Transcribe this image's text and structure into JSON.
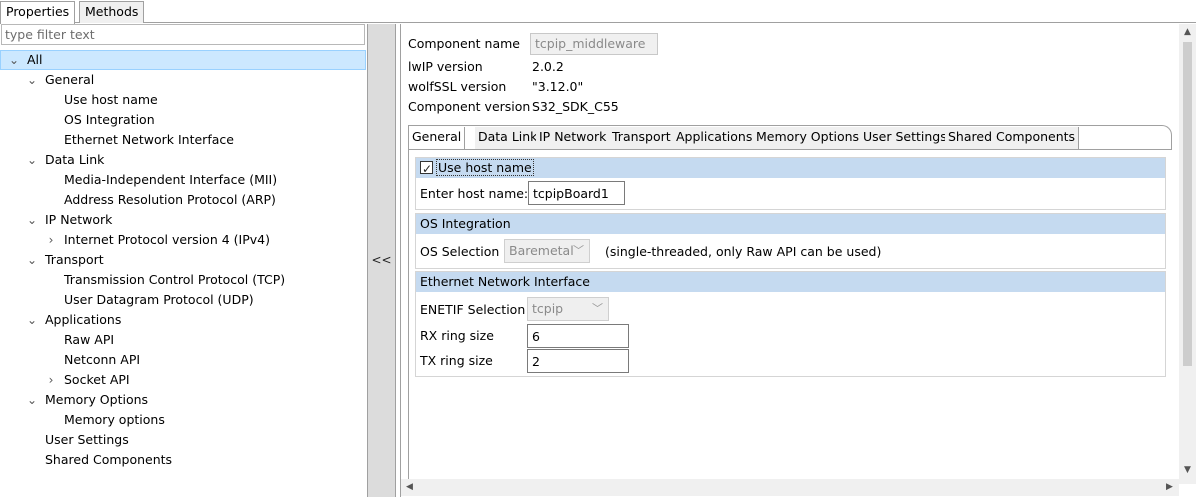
{
  "top_tabs": [
    {
      "label": "Properties",
      "active": true
    },
    {
      "label": "Methods",
      "active": false
    }
  ],
  "filter": {
    "placeholder": "type filter text"
  },
  "tree": [
    {
      "label": "All",
      "expander": "open",
      "selected": true
    },
    {
      "label": "General",
      "expander": "open"
    },
    {
      "label": "Use host name"
    },
    {
      "label": "OS Integration"
    },
    {
      "label": "Ethernet Network Interface"
    },
    {
      "label": "Data Link",
      "expander": "open"
    },
    {
      "label": "Media-Independent Interface (MII)"
    },
    {
      "label": "Address Resolution Protocol (ARP)"
    },
    {
      "label": "IP Network",
      "expander": "open"
    },
    {
      "label": "Internet Protocol version 4 (IPv4)",
      "expander": "closed"
    },
    {
      "label": "Transport",
      "expander": "open"
    },
    {
      "label": "Transmission Control Protocol (TCP)"
    },
    {
      "label": "User Datagram Protocol (UDP)"
    },
    {
      "label": "Applications",
      "expander": "open"
    },
    {
      "label": "Raw API"
    },
    {
      "label": "Netconn API"
    },
    {
      "label": "Socket API",
      "expander": "closed"
    },
    {
      "label": "Memory Options",
      "expander": "open"
    },
    {
      "label": "Memory options"
    },
    {
      "label": "User Settings"
    },
    {
      "label": "Shared Components"
    }
  ],
  "collapse_button": {
    "label": "<<"
  },
  "info": {
    "component_name_label": "Component name",
    "component_name_value": "tcpip_middleware",
    "lwip_label": "lwIP version",
    "lwip_value": "2.0.2",
    "wolfssl_label": "wolfSSL version",
    "wolfssl_value": "\"3.12.0\"",
    "component_version_label": "Component version",
    "component_version_value": "S32_SDK_C55"
  },
  "inner_tabs": [
    {
      "label": "General",
      "active": true
    },
    {
      "label": "Data Link"
    },
    {
      "label": "IP Network"
    },
    {
      "label": "Transport"
    },
    {
      "label": "Applications"
    },
    {
      "label": "Memory Options"
    },
    {
      "label": "User Settings"
    },
    {
      "label": "Shared Components"
    }
  ],
  "use_host": {
    "title": "Use host name",
    "checked": true,
    "host_label": "Enter host name:",
    "host_value": "tcpipBoard1"
  },
  "os": {
    "title": "OS Integration",
    "selection_label": "OS Selection",
    "selection_value": "Baremetal",
    "note": "(single-threaded, only Raw API can be used)"
  },
  "eth": {
    "title": "Ethernet Network Interface",
    "enetif_label": "ENETIF Selection",
    "enetif_value": "tcpip",
    "rx_label": "RX ring size",
    "rx_value": "6",
    "tx_label": "TX ring size",
    "tx_value": "2"
  },
  "icons": {
    "expanded": "chevron-down-icon",
    "collapsed": "chevron-right-icon",
    "dropdown": "chevron-down-icon",
    "checkbox": "check-icon"
  },
  "colors": {
    "selection": "#cce8ff",
    "section_header": "#c5daf0",
    "collapse_bar": "#dcdcdc"
  }
}
